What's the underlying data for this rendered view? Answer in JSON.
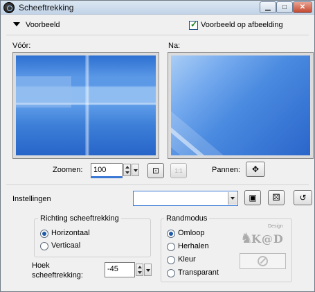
{
  "window": {
    "title": "Scheeftrekking"
  },
  "preview": {
    "section_label": "Voorbeeld",
    "on_image_label": "Voorbeeld op afbeelding",
    "on_image_checked": true,
    "before_label": "Vóór:",
    "after_label": "Na:"
  },
  "zoom": {
    "label": "Zoomen:",
    "value": "100",
    "pan_label": "Pannen:"
  },
  "settings": {
    "label": "Instellingen",
    "value": ""
  },
  "direction": {
    "title": "Richting scheeftrekking",
    "options": [
      {
        "label": "Horizontaal",
        "selected": true
      },
      {
        "label": "Verticaal",
        "selected": false
      }
    ]
  },
  "edge_mode": {
    "title": "Randmodus",
    "options": [
      {
        "label": "Omloop",
        "selected": true
      },
      {
        "label": "Herhalen",
        "selected": false
      },
      {
        "label": "Kleur",
        "selected": false
      },
      {
        "label": "Transparant",
        "selected": false
      }
    ]
  },
  "angle": {
    "label_line1": "Hoek",
    "label_line2": "scheeftrekking:",
    "value": "-45"
  },
  "watermark": {
    "text": "K@D",
    "small": "Design"
  },
  "icons": {
    "app": "app-camera-icon",
    "zoom_fit": "fit-to-window-icon",
    "zoom_actual": "actual-size-icon",
    "pan": "pan-move-icon",
    "save": "save-disk-icon",
    "random": "randomize-dice-icon",
    "reset": "reset-icon",
    "disabled": "disabled-icon"
  },
  "colors": {
    "accent": "#3a78d6"
  }
}
